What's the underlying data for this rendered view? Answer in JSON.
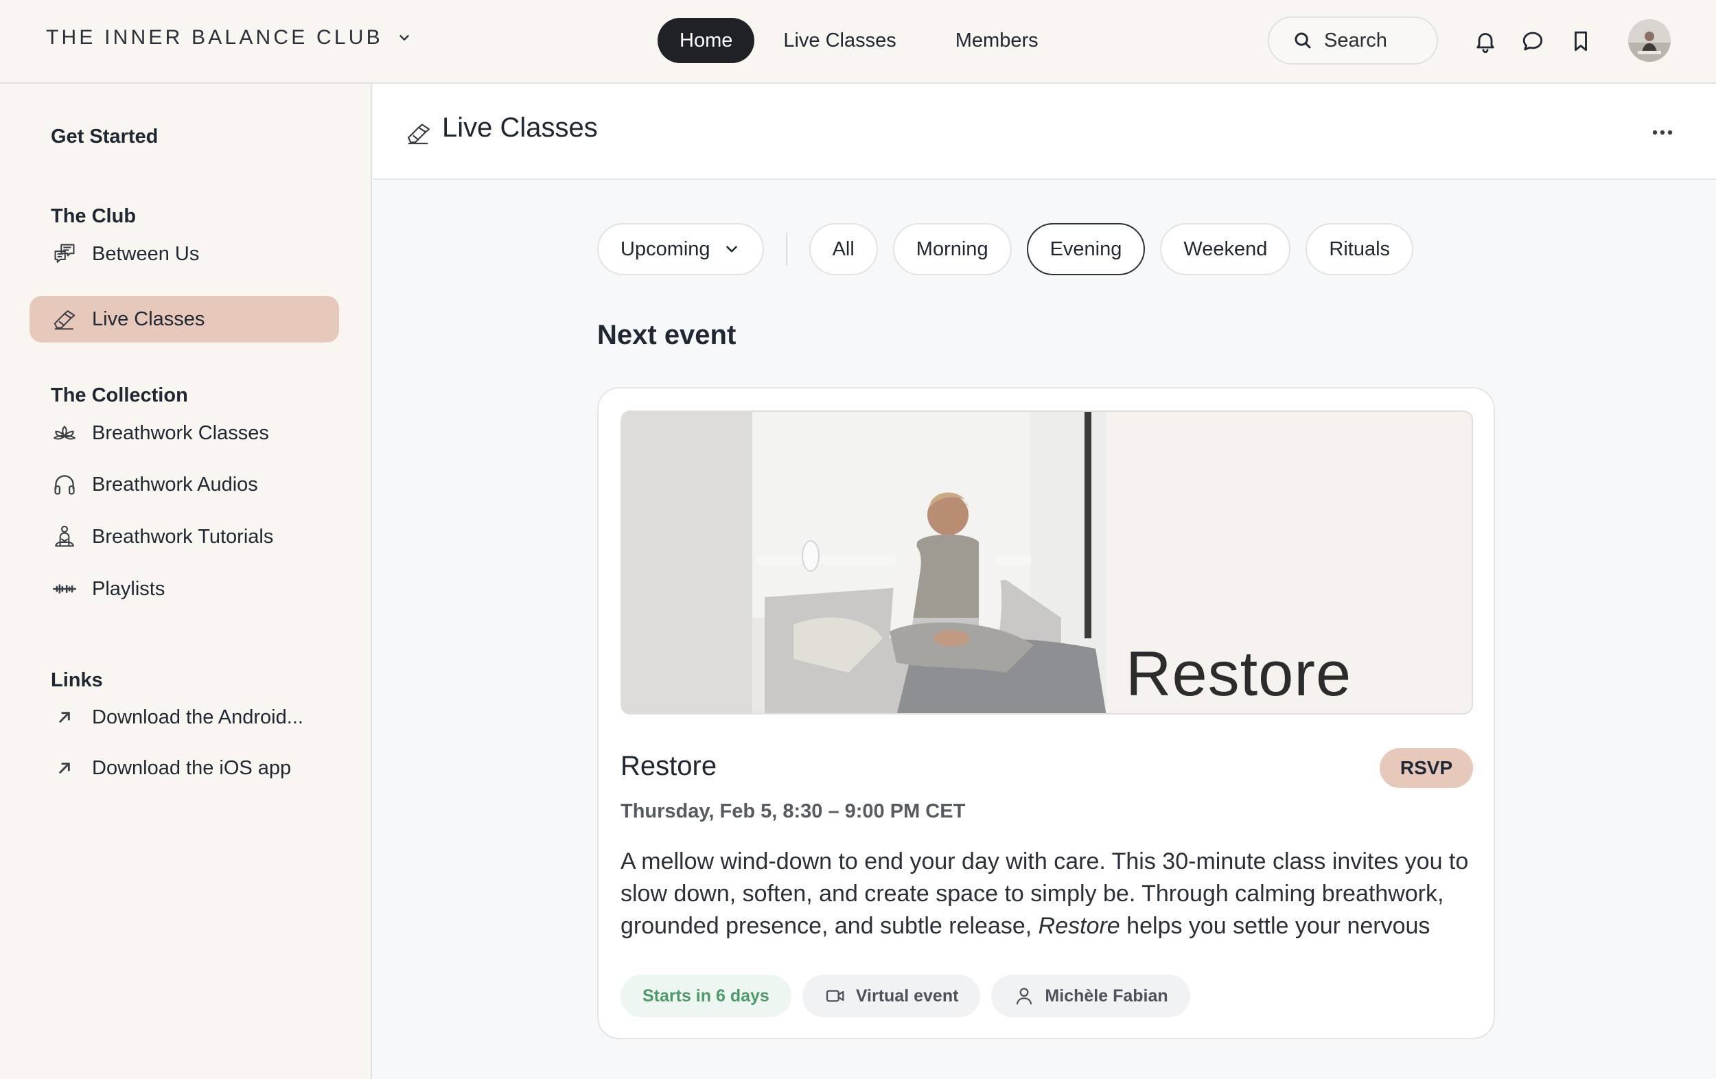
{
  "header": {
    "brand": "THE INNER BALANCE CLUB",
    "nav": [
      {
        "label": "Home",
        "active": true
      },
      {
        "label": "Live Classes",
        "active": false
      },
      {
        "label": "Members",
        "active": false
      }
    ],
    "search_label": "Search"
  },
  "sidebar": {
    "sections": [
      {
        "title": "Get Started",
        "items": []
      },
      {
        "title": "The Club",
        "items": [
          {
            "label": "Between Us",
            "icon": "chat-bubbles-icon"
          },
          {
            "label": "Live Classes",
            "icon": "eraser-icon",
            "active": true
          }
        ]
      },
      {
        "title": "The Collection",
        "items": [
          {
            "label": "Breathwork Classes",
            "icon": "lotus-icon"
          },
          {
            "label": "Breathwork Audios",
            "icon": "headphones-icon"
          },
          {
            "label": "Breathwork Tutorials",
            "icon": "meditation-icon"
          },
          {
            "label": "Playlists",
            "icon": "sound-wave-icon"
          }
        ]
      },
      {
        "title": "Links",
        "items": [
          {
            "label": "Download the Android...",
            "icon": "external-link-icon"
          },
          {
            "label": "Download the iOS app",
            "icon": "external-link-icon"
          }
        ]
      }
    ]
  },
  "page": {
    "title": "Live Classes",
    "filters": {
      "dropdown": "Upcoming",
      "chips": [
        {
          "label": "All",
          "selected": false
        },
        {
          "label": "Morning",
          "selected": false
        },
        {
          "label": "Evening",
          "selected": true
        },
        {
          "label": "Weekend",
          "selected": false
        },
        {
          "label": "Rituals",
          "selected": false
        }
      ]
    },
    "section_title": "Next event",
    "event": {
      "banner_text": "Restore",
      "title": "Restore",
      "rsvp": "RSVP",
      "date": "Thursday, Feb 5, 8:30 – 9:00 PM CET",
      "description_before": "A mellow wind-down to end your day with care. This 30-minute class invites you to slow down, soften, and create space to simply be. Through calming breathwork, grounded presence, and subtle release, ",
      "description_em": "Restore",
      "description_after": " helps you settle your nervous",
      "tags": {
        "starts": "Starts in 6 days",
        "type": "Virtual event",
        "host": "Michèle Fabian"
      }
    }
  },
  "colors": {
    "accent": "#e6c9bb",
    "nav_active_bg": "#1f2127",
    "sidebar_bg": "#f9f6f2",
    "tag_green": "#4e9a6b"
  }
}
